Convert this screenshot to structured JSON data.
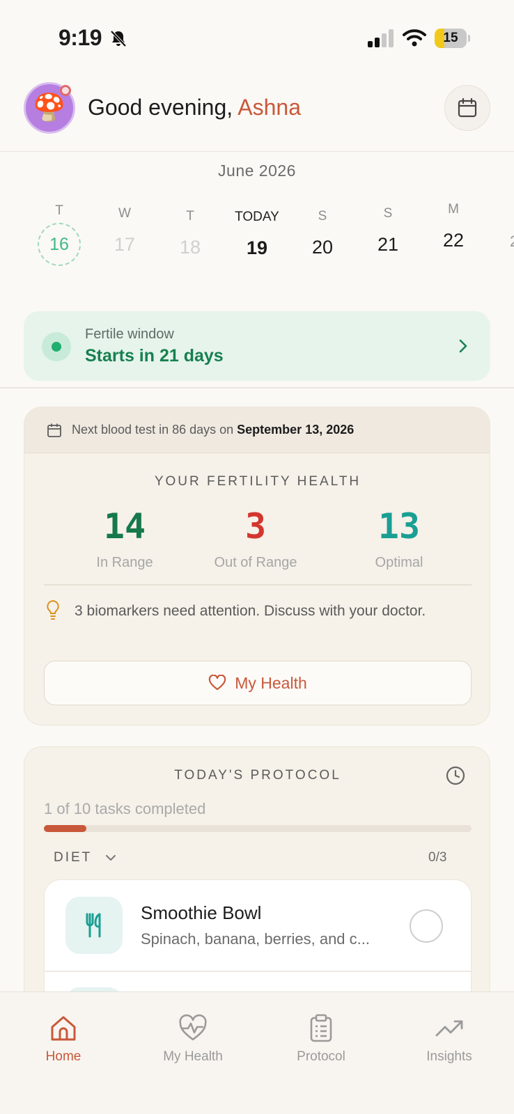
{
  "status_bar": {
    "time": "9:19",
    "battery": "15"
  },
  "header": {
    "greeting": "Good evening, ",
    "user_name": "Ashna",
    "avatar_emoji": "🍄"
  },
  "calendar": {
    "month": "June 2026",
    "days": [
      {
        "weekday": "T",
        "date": "16",
        "state": "period"
      },
      {
        "weekday": "W",
        "date": "17",
        "state": "past"
      },
      {
        "weekday": "T",
        "date": "18",
        "state": "past"
      },
      {
        "weekday": "TODAY",
        "date": "19",
        "state": "today"
      },
      {
        "weekday": "S",
        "date": "20",
        "state": "future"
      },
      {
        "weekday": "S",
        "date": "21",
        "state": "future"
      },
      {
        "weekday": "M",
        "date": "22",
        "state": "future"
      }
    ]
  },
  "fertile": {
    "label": "Fertile window",
    "value": "Starts in 21 days"
  },
  "health": {
    "blood_test_prefix": "Next blood test in 86 days on ",
    "blood_test_date": "September 13, 2026",
    "title": "YOUR FERTILITY HEALTH",
    "metrics": [
      {
        "value": "14",
        "label": "In Range",
        "color": "#16794b"
      },
      {
        "value": "3",
        "label": "Out of Range",
        "color": "#d3362e"
      },
      {
        "value": "13",
        "label": "Optimal",
        "color": "#1a9f94"
      }
    ],
    "attention": "3 biomarkers need attention. Discuss with your doctor.",
    "button_label": "My Health"
  },
  "protocol": {
    "title": "TODAY'S PROTOCOL",
    "tasks_completed_text": "1 of 10 tasks completed",
    "progress_fraction": 0.1,
    "section_label": "DIET",
    "section_count": "0/3",
    "tasks": [
      {
        "title": "Smoothie Bowl",
        "subtitle": "Spinach, banana, berries, and c..."
      }
    ]
  },
  "tabbar": {
    "tabs": [
      {
        "label": "Home",
        "icon": "home-icon",
        "active": true
      },
      {
        "label": "My Health",
        "icon": "heart-pulse-icon",
        "active": false
      },
      {
        "label": "Protocol",
        "icon": "clipboard-icon",
        "active": false
      },
      {
        "label": "Insights",
        "icon": "trending-up-icon",
        "active": false
      }
    ]
  },
  "colors": {
    "accent": "#c8583a",
    "fertile_green": "#17804f",
    "background": "#fbf9f5"
  }
}
